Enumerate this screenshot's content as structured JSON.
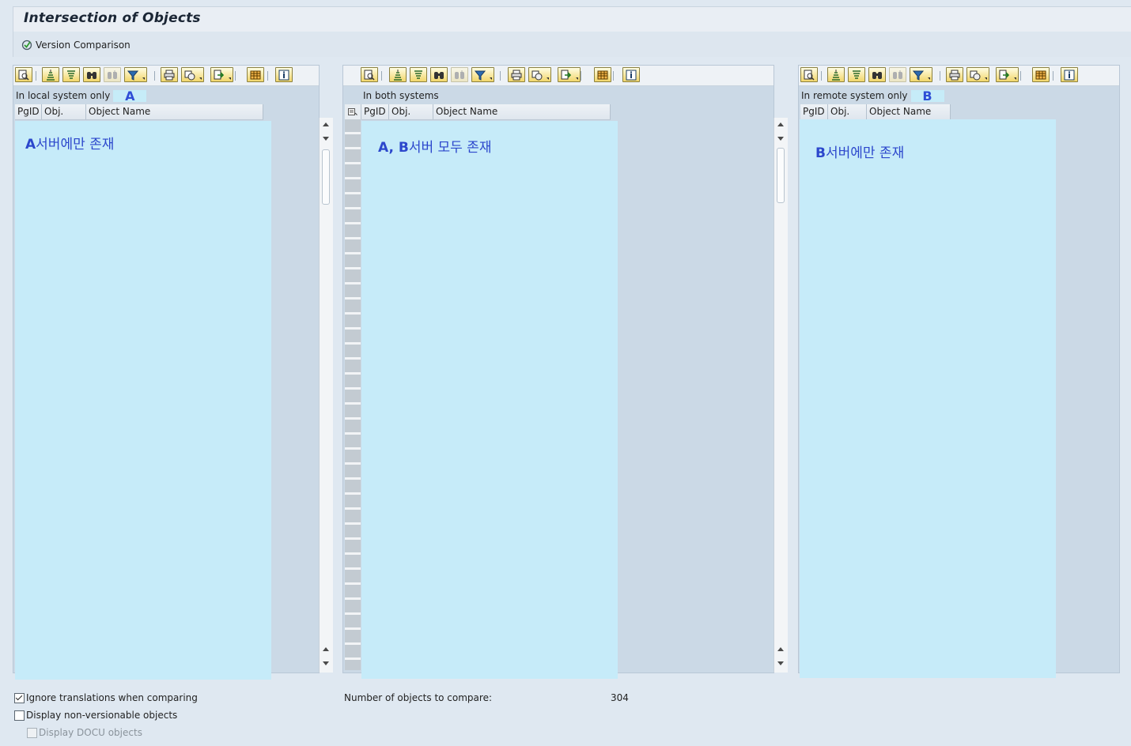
{
  "window": {
    "title": "Intersection of Objects"
  },
  "app_toolbar": {
    "version_comparison_label": "Version Comparison"
  },
  "panels": [
    {
      "grid_title": "In local system only",
      "highlight_mark": "A",
      "columns": [
        "PgID",
        "Obj.",
        "Object Name"
      ],
      "annotation": {
        "bold": "A",
        "text": "서버에만 존재"
      }
    },
    {
      "grid_title": "In both systems",
      "highlight_mark": "",
      "columns": [
        "PgID",
        "Obj.",
        "Object Name"
      ],
      "annotation": {
        "bold": "A, B",
        "text": "서버 모두 존재"
      }
    },
    {
      "grid_title": "In remote system only",
      "highlight_mark": "B",
      "columns": [
        "PgID",
        "Obj.",
        "Object Name"
      ],
      "annotation": {
        "bold": "B",
        "text": "서버에만 존재"
      }
    }
  ],
  "toolbar_icons": [
    "details-icon",
    "sort-ascending-icon",
    "sort-descending-icon",
    "find-icon",
    "find-next-icon",
    "filter-icon",
    "print-icon",
    "views-icon",
    "export-icon",
    "layout-icon",
    "info-icon"
  ],
  "options": {
    "ignore_translations": {
      "label": "Ignore translations when comparing",
      "checked": true
    },
    "display_non_versionable": {
      "label": "Display non-versionable objects",
      "checked": false
    },
    "display_docu": {
      "label": "Display DOCU objects",
      "checked": false,
      "disabled": true
    }
  },
  "summary": {
    "label": "Number of objects to compare:",
    "value": "304"
  },
  "colors": {
    "highlight": "#c6ebf9",
    "annotation_text": "#2c47cc",
    "background": "#dfe8f1"
  }
}
